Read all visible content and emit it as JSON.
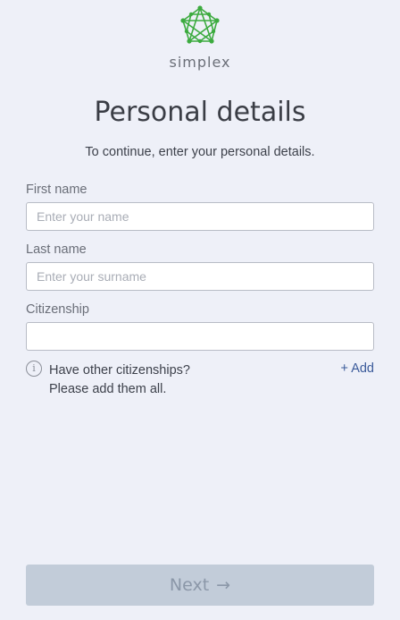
{
  "brand": {
    "name": "simplex",
    "accent_color": "#3cab3f",
    "logo_icon": "network-globe-icon"
  },
  "page": {
    "title": "Personal details",
    "subtitle": "To continue, enter your personal details."
  },
  "form": {
    "first_name": {
      "label": "First name",
      "placeholder": "Enter your name",
      "value": ""
    },
    "last_name": {
      "label": "Last name",
      "placeholder": "Enter your surname",
      "value": ""
    },
    "citizenship": {
      "label": "Citizenship",
      "placeholder": "",
      "value": ""
    }
  },
  "other_citizenships": {
    "icon": "info-icon",
    "line1": "Have other citizenships?",
    "line2": "Please add them all.",
    "add_label": "+ Add"
  },
  "actions": {
    "next_label": "Next",
    "next_arrow": "→",
    "next_enabled": false
  }
}
